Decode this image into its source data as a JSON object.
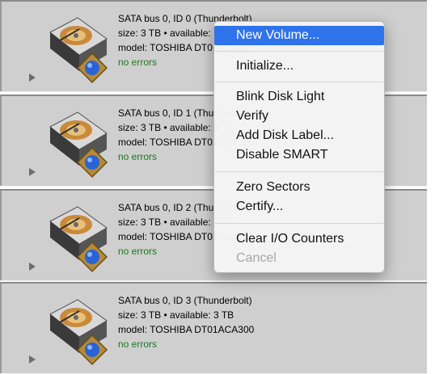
{
  "disks": [
    {
      "bus": "SATA bus 0, ID 0 (Thunderbolt)",
      "size": "size: 3 TB • available: 3 TB",
      "model": "model: TOSHIBA DT01ACA300",
      "status": "no errors"
    },
    {
      "bus": "SATA bus 0, ID 1 (Thunderbolt)",
      "size": "size: 3 TB • available: 3 TB",
      "model": "model: TOSHIBA DT01ACA300",
      "status": "no errors"
    },
    {
      "bus": "SATA bus 0, ID 2 (Thunderbolt)",
      "size": "size: 3 TB • available: 3 TB",
      "model": "model: TOSHIBA DT01ACA300",
      "status": "no errors"
    },
    {
      "bus": "SATA bus 0, ID 3 (Thunderbolt)",
      "size": "size: 3 TB • available: 3 TB",
      "model": "model: TOSHIBA DT01ACA300",
      "status": "no errors"
    }
  ],
  "context_menu": {
    "new_volume": "New Volume...",
    "initialize": "Initialize...",
    "blink_disk_light": "Blink Disk Light",
    "verify": "Verify",
    "add_disk_label": "Add Disk Label...",
    "disable_smart": "Disable SMART",
    "zero_sectors": "Zero Sectors",
    "certify": "Certify...",
    "clear_io_counters": "Clear I/O Counters",
    "cancel": "Cancel"
  },
  "colors": {
    "row_background": "#cfcfcf",
    "status_ok": "#1c7a1c",
    "menu_highlight": "#2f73ea"
  },
  "icons": {
    "disk": "hard-drive-icon",
    "badge": "blue-globe-badge-icon",
    "expand": "disclosure-triangle-icon"
  }
}
